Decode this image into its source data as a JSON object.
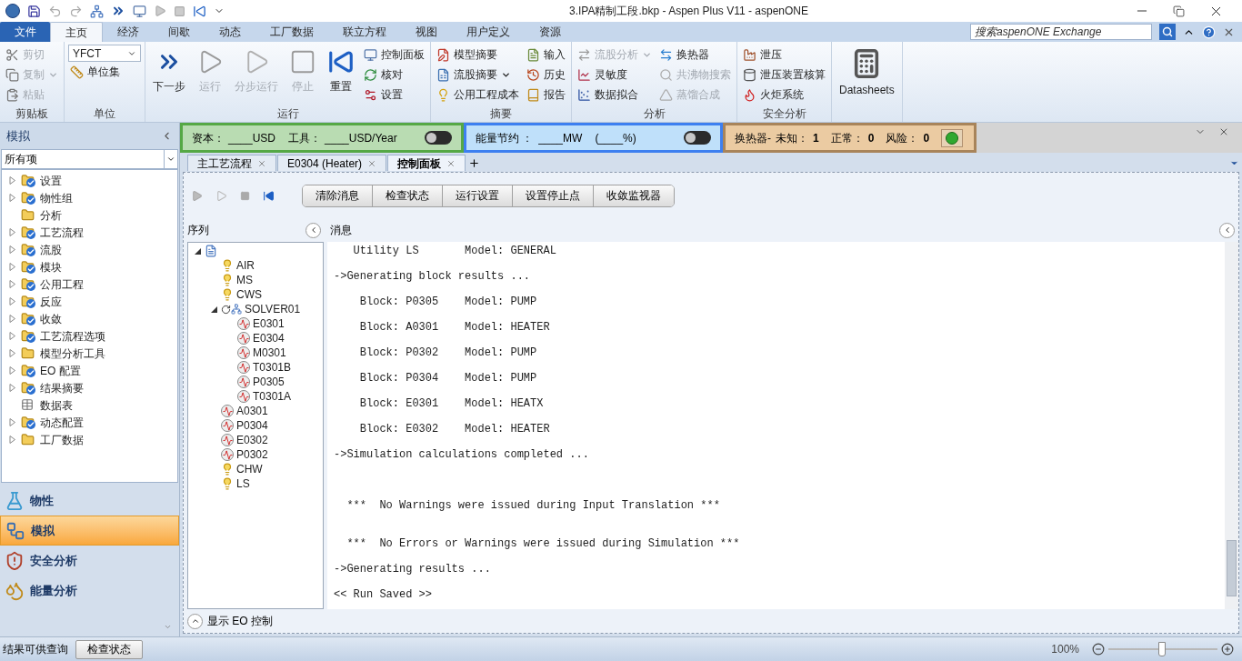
{
  "window": {
    "title": "3.IPA精制工段.bkp - Aspen Plus V11 - aspenONE"
  },
  "ribbon": {
    "tabs": [
      {
        "label": "文件",
        "kind": "file",
        "selected": false
      },
      {
        "label": "主页",
        "kind": "tab",
        "selected": true
      },
      {
        "label": "经济",
        "kind": "tab",
        "selected": false
      },
      {
        "label": "间歇",
        "kind": "tab",
        "selected": false
      },
      {
        "label": "动态",
        "kind": "tab",
        "selected": false
      },
      {
        "label": "工厂数据",
        "kind": "tab",
        "selected": false
      },
      {
        "label": "联立方程",
        "kind": "tab",
        "selected": false
      },
      {
        "label": "视图",
        "kind": "tab",
        "selected": false
      },
      {
        "label": "用户定义",
        "kind": "tab",
        "selected": false
      },
      {
        "label": "资源",
        "kind": "tab",
        "selected": false
      }
    ],
    "search": {
      "placeholder": "搜索aspenONE Exchange"
    },
    "groups": [
      {
        "label": "剪贴板",
        "items": [
          {
            "kind": "small",
            "label": "剪切",
            "disabled": true,
            "menu": false
          },
          {
            "kind": "small",
            "label": "复制",
            "disabled": true,
            "menu": true
          },
          {
            "kind": "small",
            "label": "粘贴",
            "disabled": true,
            "menu": false
          }
        ]
      },
      {
        "label": "单位",
        "items": [
          {
            "kind": "combo",
            "value": "YFCT"
          },
          {
            "kind": "small",
            "label": "单位集",
            "disabled": false,
            "menu": false
          }
        ]
      },
      {
        "label": "运行",
        "items": [
          {
            "kind": "large",
            "label": "下一步",
            "disabled": false,
            "menu": false
          },
          {
            "kind": "large",
            "label": "运行",
            "disabled": true,
            "menu": false
          },
          {
            "kind": "large",
            "label": "分步运行",
            "disabled": true,
            "menu": false
          },
          {
            "kind": "large",
            "label": "停止",
            "disabled": true,
            "menu": false
          },
          {
            "kind": "large",
            "label": "重置",
            "disabled": false,
            "menu": false
          },
          {
            "kind": "small",
            "label": "控制面板",
            "disabled": false,
            "menu": false
          },
          {
            "kind": "small",
            "label": "核对",
            "disabled": false,
            "menu": false
          },
          {
            "kind": "small",
            "label": "设置",
            "disabled": false,
            "menu": false
          }
        ]
      },
      {
        "label": "摘要",
        "items": [
          {
            "kind": "small",
            "label": "模型摘要",
            "disabled": false,
            "menu": false
          },
          {
            "kind": "small",
            "label": "流股摘要",
            "disabled": false,
            "menu": true
          },
          {
            "kind": "small",
            "label": "公用工程成本",
            "disabled": false,
            "menu": false
          },
          {
            "kind": "small",
            "label": "输入",
            "disabled": false,
            "menu": false
          },
          {
            "kind": "small",
            "label": "历史",
            "disabled": false,
            "menu": false
          },
          {
            "kind": "small",
            "label": "报告",
            "disabled": false,
            "menu": false
          }
        ]
      },
      {
        "label": "分析",
        "items": [
          {
            "kind": "small",
            "label": "流股分析",
            "disabled": true,
            "menu": true
          },
          {
            "kind": "small",
            "label": "灵敏度",
            "disabled": false,
            "menu": false
          },
          {
            "kind": "small",
            "label": "数据拟合",
            "disabled": false,
            "menu": false
          },
          {
            "kind": "small",
            "label": "换热器",
            "disabled": false,
            "menu": false
          },
          {
            "kind": "small",
            "label": "共沸物搜索",
            "disabled": true,
            "menu": false
          },
          {
            "kind": "small",
            "label": "蒸馏合成",
            "disabled": true,
            "menu": false
          }
        ]
      },
      {
        "label": "安全分析",
        "items": [
          {
            "kind": "small",
            "label": "泄压",
            "disabled": false,
            "menu": false
          },
          {
            "kind": "small",
            "label": "泄压装置核算",
            "disabled": false,
            "menu": false
          },
          {
            "kind": "small",
            "label": "火炬系统",
            "disabled": false,
            "menu": false
          }
        ]
      },
      {
        "items": [
          {
            "kind": "large",
            "label": "Datasheets",
            "disabled": false,
            "menu": false
          }
        ]
      }
    ]
  },
  "sidebar": {
    "title": "模拟",
    "filter": "所有项",
    "items": [
      {
        "label": "设置",
        "kind": "folder",
        "has_children": true,
        "checked": true
      },
      {
        "label": "物性组",
        "kind": "folder",
        "has_children": true,
        "checked": true
      },
      {
        "label": "分析",
        "kind": "folder",
        "has_children": false,
        "checked": false
      },
      {
        "label": "工艺流程",
        "kind": "folder",
        "has_children": true,
        "checked": true
      },
      {
        "label": "流股",
        "kind": "folder",
        "has_children": true,
        "checked": true
      },
      {
        "label": "模块",
        "kind": "folder",
        "has_children": true,
        "checked": true
      },
      {
        "label": "公用工程",
        "kind": "folder",
        "has_children": true,
        "checked": true
      },
      {
        "label": "反应",
        "kind": "folder",
        "has_children": true,
        "checked": true
      },
      {
        "label": "收敛",
        "kind": "folder",
        "has_children": true,
        "checked": true
      },
      {
        "label": "工艺流程选项",
        "kind": "folder",
        "has_children": true,
        "checked": true
      },
      {
        "label": "模型分析工具",
        "kind": "folder",
        "has_children": true,
        "checked": false
      },
      {
        "label": "EO 配置",
        "kind": "folder",
        "has_children": true,
        "checked": true
      },
      {
        "label": "结果摘要",
        "kind": "folder",
        "has_children": true,
        "checked": true
      },
      {
        "label": "数据表",
        "kind": "table",
        "has_children": false,
        "checked": false
      },
      {
        "label": "动态配置",
        "kind": "folder",
        "has_children": true,
        "checked": true
      },
      {
        "label": "工厂数据",
        "kind": "folder",
        "has_children": true,
        "checked": false
      }
    ],
    "nav": [
      {
        "label": "物性",
        "selected": false
      },
      {
        "label": "模拟",
        "selected": true
      },
      {
        "label": "安全分析",
        "selected": false
      },
      {
        "label": "能量分析",
        "selected": false
      }
    ]
  },
  "metrics": {
    "capital": {
      "label": "资本：",
      "value": "____USD",
      "label2": "工具：",
      "value2": "____USD/Year",
      "on": false
    },
    "energy": {
      "label": "能量节约 ：",
      "value": "____MW",
      "value2": "(____%)",
      "on": false
    },
    "exchangers": {
      "label": "换热器-",
      "counts": [
        {
          "label": "未知：",
          "value": "1"
        },
        {
          "label": "正常：",
          "value": "0"
        },
        {
          "label": "风险：",
          "value": "0"
        }
      ]
    }
  },
  "doc_tabs": [
    {
      "label": "主工艺流程",
      "selected": false
    },
    {
      "label": "E0304 (Heater)",
      "selected": false
    },
    {
      "label": "控制面板",
      "selected": true
    }
  ],
  "control_panel": {
    "buttons": [
      "清除消息",
      "检查状态",
      "运行设置",
      "设置停止点",
      "收敛监视器"
    ],
    "sequence_title": "序列",
    "messages_title": "消息",
    "sequence": [
      {
        "kind": "document",
        "expanded": true,
        "children": [
          {
            "kind": "utility",
            "label": "AIR"
          },
          {
            "kind": "utility",
            "label": "MS"
          },
          {
            "kind": "utility",
            "label": "CWS"
          },
          {
            "kind": "solver",
            "label": "SOLVER01",
            "expanded": true,
            "children": [
              {
                "kind": "block",
                "label": "E0301"
              },
              {
                "kind": "block",
                "label": "E0304"
              },
              {
                "kind": "block",
                "label": "M0301"
              },
              {
                "kind": "block",
                "label": "T0301B"
              },
              {
                "kind": "block",
                "label": "P0305"
              },
              {
                "kind": "block",
                "label": "T0301A"
              }
            ]
          },
          {
            "kind": "block",
            "label": "A0301"
          },
          {
            "kind": "block",
            "label": "P0304"
          },
          {
            "kind": "block",
            "label": "E0302"
          },
          {
            "kind": "block",
            "label": "P0302"
          },
          {
            "kind": "utility",
            "label": "CHW"
          },
          {
            "kind": "utility",
            "label": "LS"
          }
        ]
      }
    ],
    "log": "   Utility LS       Model: GENERAL\n\n->Generating block results ...\n\n    Block: P0305    Model: PUMP\n\n    Block: A0301    Model: HEATER\n\n    Block: P0302    Model: PUMP\n\n    Block: P0304    Model: PUMP\n\n    Block: E0301    Model: HEATX\n\n    Block: E0302    Model: HEATER\n\n->Simulation calculations completed ...\n\n\n\n  ***  No Warnings were issued during Input Translation ***\n\n\n  ***  No Errors or Warnings were issued during Simulation ***\n\n->Generating results ...\n\n<< Run Saved >>",
    "eo_toggle": "显示 EO 控制"
  },
  "status_bar": {
    "message": "结果可供查询",
    "button": "检查状态",
    "zoom": "100%",
    "level": 0.49
  }
}
